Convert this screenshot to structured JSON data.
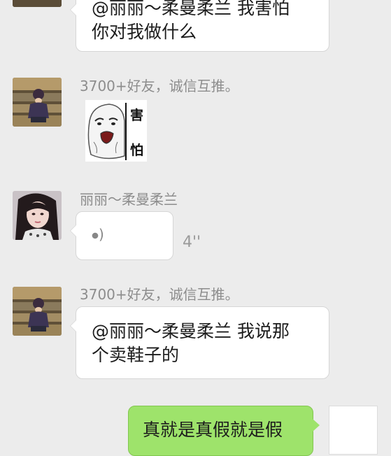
{
  "messages": [
    {
      "text": "@丽丽～柔曼柔兰 我害怕\n你对我做什么"
    },
    {
      "sender": "3700+好友，诚信互推。",
      "sticker": {
        "top_char": "害",
        "bottom_char": "怕"
      }
    },
    {
      "sender": "丽丽～柔曼柔兰",
      "voice": {
        "duration": "4''",
        "icon": "voice-wave-icon"
      }
    },
    {
      "sender": "3700+好友，诚信互推。",
      "text": "@丽丽～柔曼柔兰 我说那\n个卖鞋子的"
    },
    {
      "text": "真就是真假就是假"
    }
  ],
  "colors": {
    "background": "#ececec",
    "bubble_incoming": "#ffffff",
    "bubble_outgoing": "#9ee36b",
    "sender_text": "#8d8d8d"
  }
}
